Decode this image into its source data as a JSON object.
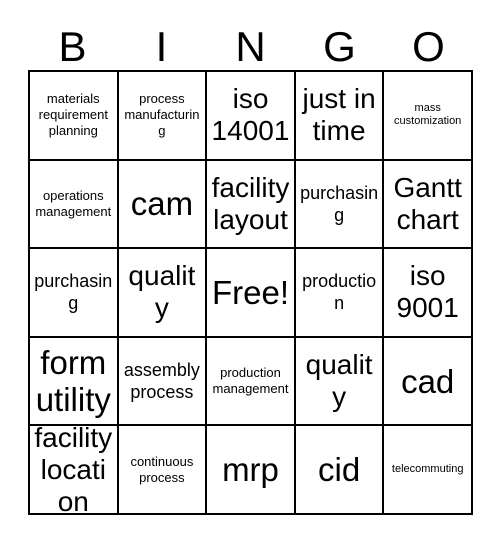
{
  "card": {
    "header_letters": [
      "B",
      "I",
      "N",
      "G",
      "O"
    ],
    "free_space_label": "Free!",
    "colors": {
      "background": "#ffffff",
      "border": "#000000",
      "text": "#000000"
    },
    "cells": [
      [
        {
          "label": "materials requirement planning",
          "size": "sm"
        },
        {
          "label": "process manufacturing",
          "size": "sm"
        },
        {
          "label": "iso 14001",
          "size": "xl"
        },
        {
          "label": "just in time",
          "size": "xl"
        },
        {
          "label": "mass customization",
          "size": "xs"
        }
      ],
      [
        {
          "label": "operations management",
          "size": "sm"
        },
        {
          "label": "cam",
          "size": "xxl"
        },
        {
          "label": "facility layout",
          "size": "xl"
        },
        {
          "label": "purchasing",
          "size": "md"
        },
        {
          "label": "Gantt chart",
          "size": "xl"
        }
      ],
      [
        {
          "label": "purchasing",
          "size": "md"
        },
        {
          "label": "quality",
          "size": "xl"
        },
        {
          "label": "Free!",
          "size": "xxl"
        },
        {
          "label": "production",
          "size": "md"
        },
        {
          "label": "iso 9001",
          "size": "xl"
        }
      ],
      [
        {
          "label": "form utility",
          "size": "xxl"
        },
        {
          "label": "assembly process",
          "size": "md"
        },
        {
          "label": "production management",
          "size": "sm"
        },
        {
          "label": "quality",
          "size": "xl"
        },
        {
          "label": "cad",
          "size": "xxl"
        }
      ],
      [
        {
          "label": "facility location",
          "size": "xl"
        },
        {
          "label": "continuous process",
          "size": "sm"
        },
        {
          "label": "mrp",
          "size": "xxl"
        },
        {
          "label": "cid",
          "size": "xxl"
        },
        {
          "label": "telecommuting",
          "size": "xs"
        }
      ]
    ]
  }
}
